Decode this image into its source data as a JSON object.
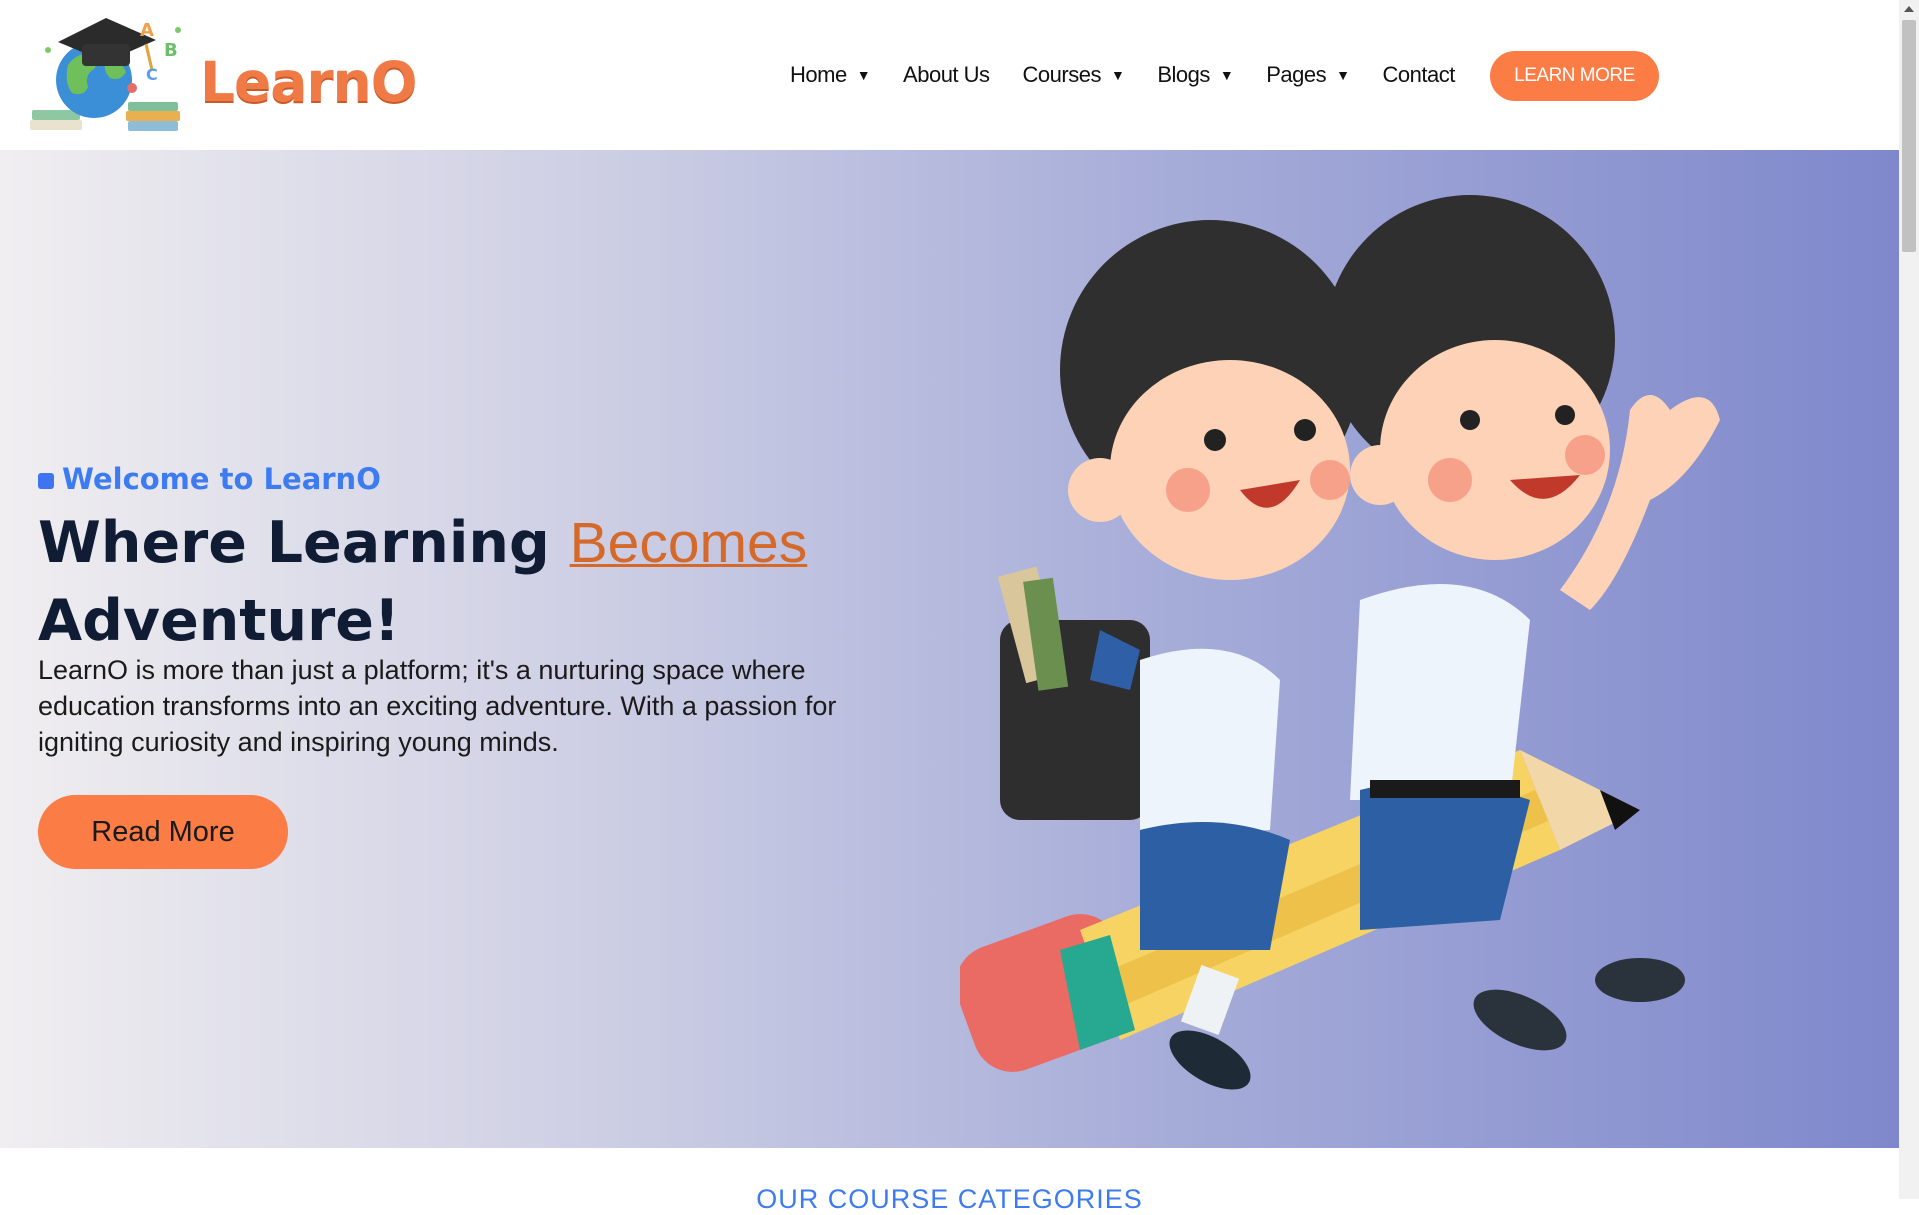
{
  "brand": {
    "name": "LearnO"
  },
  "nav": {
    "items": [
      {
        "label": "Home",
        "caret": "▼"
      },
      {
        "label": "About Us"
      },
      {
        "label": "Courses",
        "caret": "▼"
      },
      {
        "label": "Blogs",
        "caret": "▼"
      },
      {
        "label": "Pages",
        "caret": "▼"
      },
      {
        "label": "Contact"
      }
    ],
    "cta": "LEARN MORE"
  },
  "hero": {
    "tag": "Welcome to LearnO",
    "headline_pre": "Where Learning ",
    "headline_accent": "Becomes",
    "headline_post": "Adventure!",
    "description": "LearnO is more than just a platform; it's a nurturing space where education transforms into an exciting adventure. With a passion for igniting curiosity and inspiring young minds.",
    "button": "Read More"
  },
  "next_section": {
    "title": "OUR COURSE CATEGORIES"
  },
  "colors": {
    "accent": "#fb7c45",
    "brand_blue": "#3d7bf0",
    "heading": "#0f1c33"
  }
}
